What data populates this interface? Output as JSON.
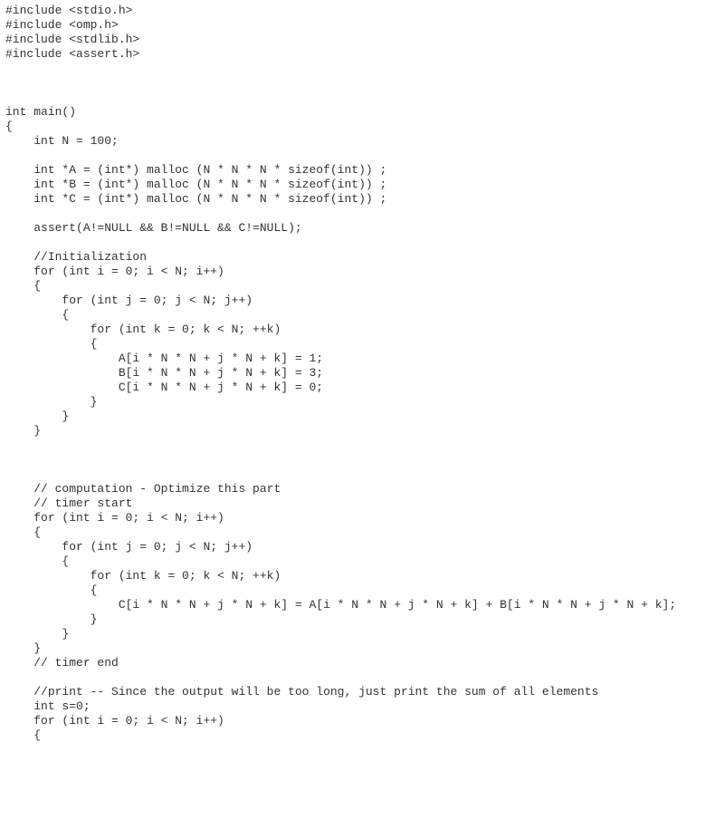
{
  "code": {
    "lines": [
      "#include <stdio.h>",
      "#include <omp.h>",
      "#include <stdlib.h>",
      "#include <assert.h>",
      "",
      "",
      "",
      "int main()",
      "{",
      "    int N = 100;",
      "",
      "    int *A = (int*) malloc (N * N * N * sizeof(int)) ;",
      "    int *B = (int*) malloc (N * N * N * sizeof(int)) ;",
      "    int *C = (int*) malloc (N * N * N * sizeof(int)) ;",
      "",
      "    assert(A!=NULL && B!=NULL && C!=NULL);",
      "",
      "    //Initialization",
      "    for (int i = 0; i < N; i++)",
      "    {",
      "        for (int j = 0; j < N; j++)",
      "        {",
      "            for (int k = 0; k < N; ++k)",
      "            {",
      "                A[i * N * N + j * N + k] = 1;",
      "                B[i * N * N + j * N + k] = 3;",
      "                C[i * N * N + j * N + k] = 0;",
      "            }",
      "        }",
      "    }",
      "",
      "",
      "",
      "    // computation - Optimize this part",
      "    // timer start",
      "    for (int i = 0; i < N; i++)",
      "    {",
      "        for (int j = 0; j < N; j++)",
      "        {",
      "            for (int k = 0; k < N; ++k)",
      "            {",
      "                C[i * N * N + j * N + k] = A[i * N * N + j * N + k] + B[i * N * N + j * N + k];",
      "            }",
      "        }",
      "    }",
      "    // timer end",
      "",
      "    //print -- Since the output will be too long, just print the sum of all elements",
      "    int s=0;",
      "    for (int i = 0; i < N; i++)",
      "    {"
    ]
  }
}
